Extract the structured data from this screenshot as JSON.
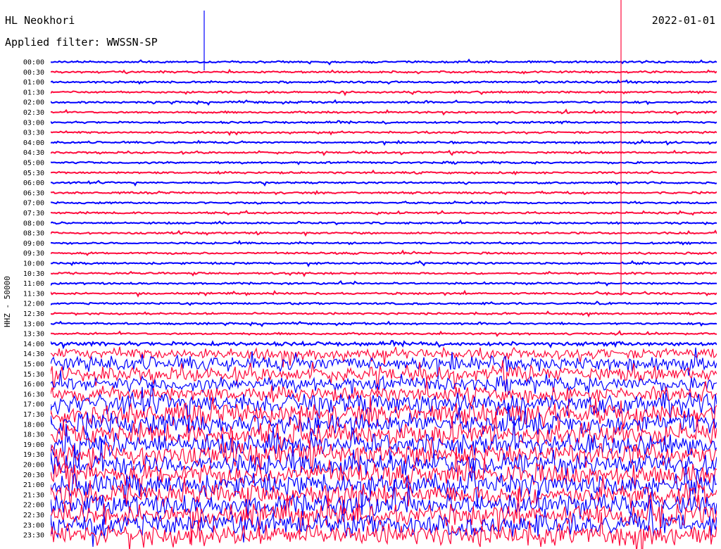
{
  "header": {
    "station": "HL Neokhori",
    "filter": "Applied filter: WWSSN-SP",
    "date": "2022-01-01"
  },
  "chart_data": {
    "type": "line",
    "title": "HL Neokhori",
    "subtitle": "Applied filter: WWSSN-SP",
    "ylabel": "HHZ - 50000",
    "colors": [
      "#0000ff",
      "#ff0a3c"
    ],
    "grid": false,
    "rows": [
      "00:00",
      "00:30",
      "01:00",
      "01:30",
      "02:00",
      "02:30",
      "03:00",
      "03:30",
      "04:00",
      "04:30",
      "05:00",
      "05:30",
      "06:00",
      "06:30",
      "07:00",
      "07:30",
      "08:00",
      "08:30",
      "09:00",
      "09:30",
      "10:00",
      "10:30",
      "11:00",
      "11:30",
      "12:00",
      "12:30",
      "13:00",
      "13:30",
      "14:00",
      "14:30",
      "15:00",
      "15:30",
      "16:00",
      "16:30",
      "17:00",
      "17:30",
      "18:00",
      "18:30",
      "19:00",
      "19:30",
      "20:00",
      "20:30",
      "21:00",
      "21:30",
      "22:00",
      "22:30",
      "23:00",
      "23:30"
    ],
    "series": [
      {
        "values": [
          1,
          1,
          1,
          1,
          1,
          1,
          1,
          1,
          1,
          1,
          1,
          1,
          1,
          1,
          1,
          1,
          1,
          1,
          1,
          1,
          1,
          1,
          1,
          1,
          1,
          1,
          1,
          1,
          2,
          6,
          8,
          8,
          8,
          8,
          12,
          12,
          12,
          12,
          12,
          12,
          12,
          12,
          12,
          12,
          12,
          12,
          12,
          12
        ]
      },
      {
        "values": [
          1,
          1,
          1,
          1,
          1,
          1,
          1,
          1,
          1,
          1,
          1,
          1,
          1,
          1,
          1,
          1,
          1,
          1,
          1,
          1,
          1,
          1,
          1,
          1,
          1,
          1,
          1,
          1,
          2,
          6,
          8,
          8,
          8,
          8,
          12,
          12,
          12,
          12,
          12,
          12,
          12,
          12,
          12,
          12,
          12,
          12,
          12,
          12
        ]
      }
    ]
  }
}
